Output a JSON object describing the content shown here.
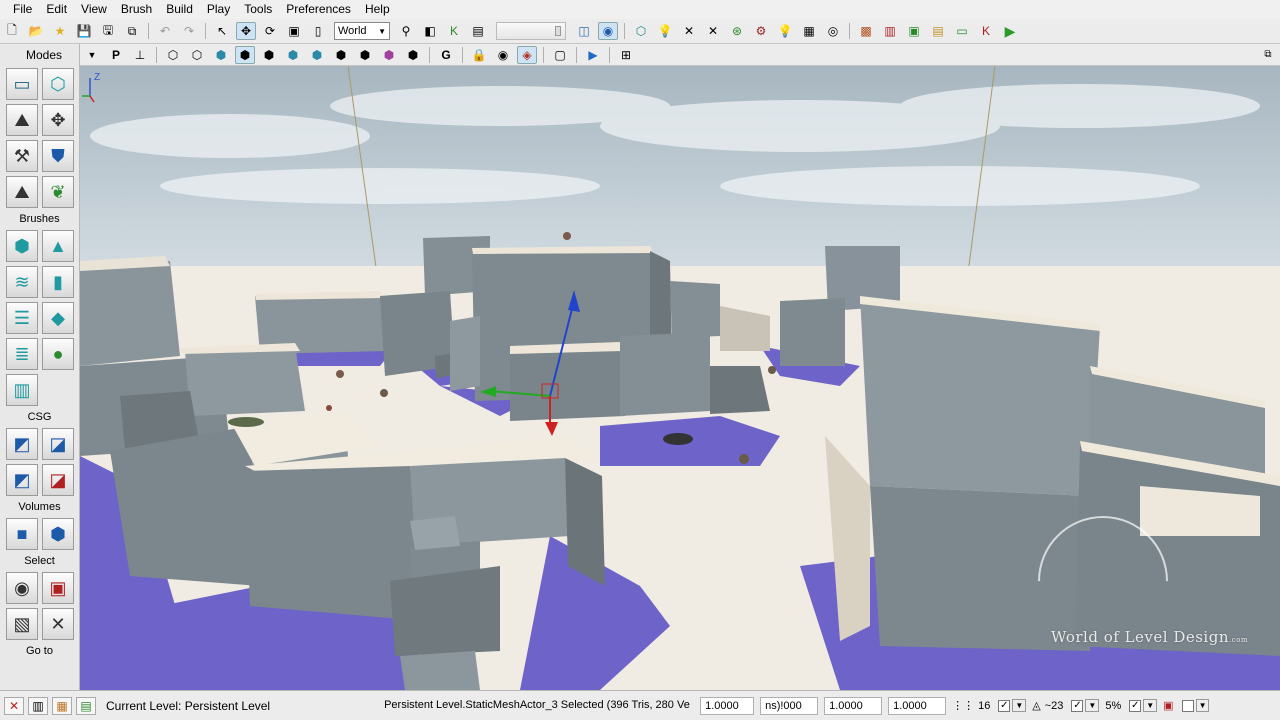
{
  "menu": [
    "File",
    "Edit",
    "View",
    "Brush",
    "Build",
    "Play",
    "Tools",
    "Preferences",
    "Help"
  ],
  "toolbar": {
    "coord_system": "World"
  },
  "left_panel": {
    "modes_title": "Modes",
    "brushes_title": "Brushes",
    "csg_title": "CSG",
    "volumes_title": "Volumes",
    "select_title": "Select",
    "goto_title": "Go to"
  },
  "toolbar2": {
    "p_label": "P",
    "g_label": "G"
  },
  "viewport": {
    "watermark_main": "World of Level Design",
    "watermark_suffix": ".com",
    "axis_z": "Z"
  },
  "status": {
    "current_level": "Current Level:  Persistent Level",
    "selection": "Persistent Level.StaticMeshActor_3 Selected (396 Tris, 280 Ve",
    "scale_x": "1.0000",
    "scale_y": "ns)!000",
    "scale_z": "1.0000",
    "scale_w": "1.0000",
    "grid": "16",
    "rot": "~23",
    "pct": "5%"
  },
  "colors": {
    "sky_top": "#aab9c4",
    "floor": "#f1ece3",
    "shadow": "#6f64c8",
    "block": "#8c969c"
  }
}
